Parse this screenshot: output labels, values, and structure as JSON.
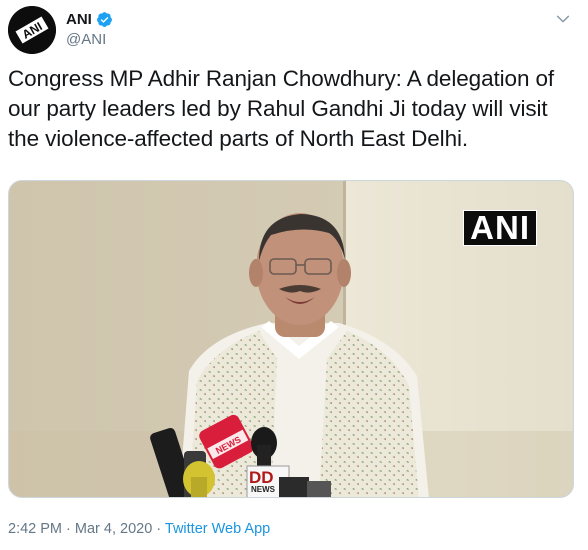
{
  "user": {
    "display_name": "ANI",
    "handle": "@ANI",
    "verified": true,
    "avatar_text": "ANI"
  },
  "tweet": {
    "text": "Congress MP Adhir Ranjan Chowdhury: A delegation of our party leaders led by Rahul Gandhi Ji today will visit the violence-affected parts of North East Delhi."
  },
  "media": {
    "watermark": "ANI",
    "mic_label": "DD",
    "mic_sublabel": "NEWS"
  },
  "footer": {
    "time": "2:42 PM",
    "separator": " · ",
    "date": "Mar 4, 2020",
    "source_app": "Twitter Web App"
  },
  "colors": {
    "link_blue": "#1b95e0",
    "verified_blue": "#1da1f2",
    "meta_gray": "#657786"
  },
  "icons": {
    "verified": "verified-badge-icon",
    "menu": "chevron-down-icon"
  }
}
